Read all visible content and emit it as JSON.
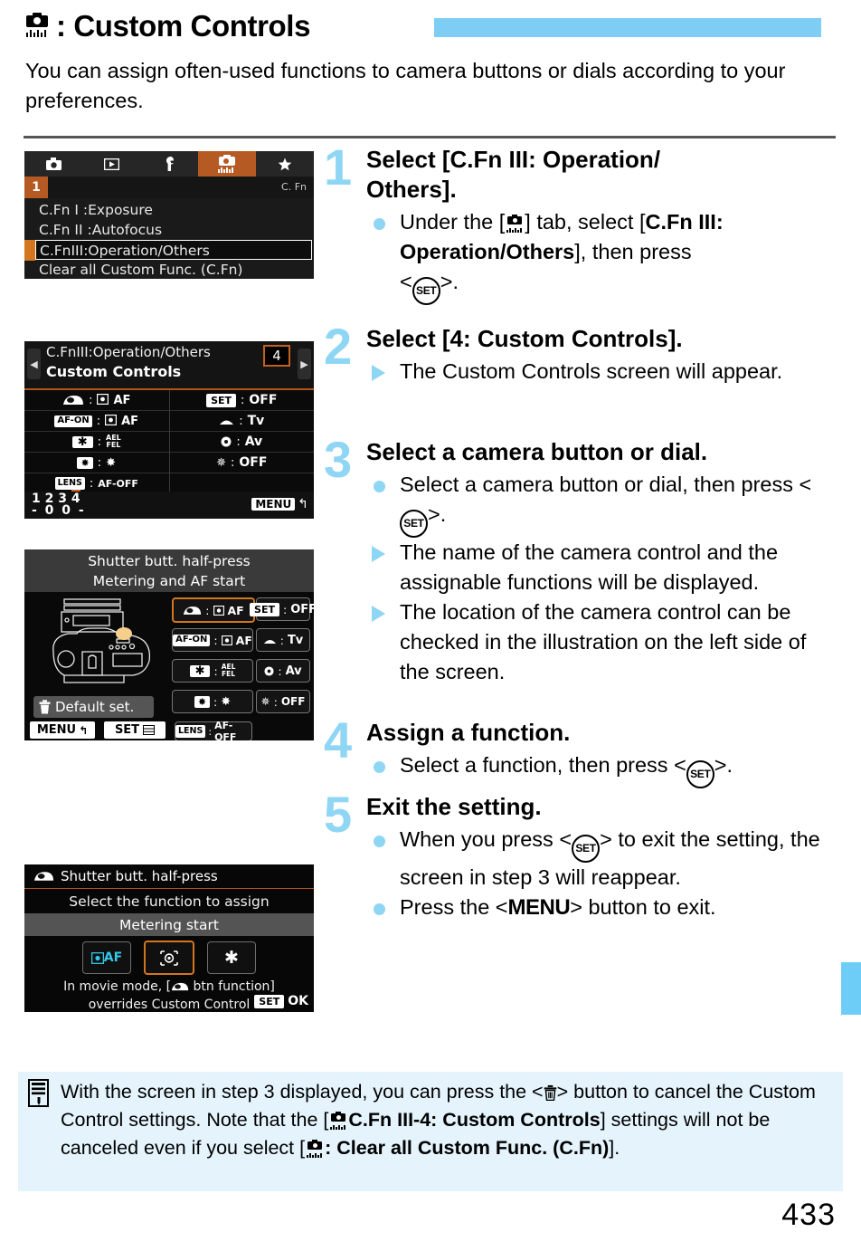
{
  "header": {
    "icon": "cfn-camera-icon",
    "title": ": Custom Controls",
    "accent_bar_color": "#7ecdf5"
  },
  "intro": "You can assign often-used functions to camera buttons or dials according to your preferences.",
  "screens": {
    "screen1": {
      "tabs": [
        "camera-icon",
        "playback-icon",
        "wrench-icon",
        "cfn-icon",
        "star-icon"
      ],
      "active_tab_index": 3,
      "page_badge": "1",
      "group_label": "C. Fn",
      "items": [
        {
          "label": "C.Fn I :Exposure",
          "selected": false
        },
        {
          "label": "C.Fn II :Autofocus",
          "selected": false
        },
        {
          "label": "C.FnIII:Operation/Others",
          "selected": true
        },
        {
          "label": "Clear all Custom Func. (C.Fn)",
          "selected": false
        }
      ]
    },
    "screen2": {
      "title_line1": "C.FnIII:Operation/Others",
      "title_line2": "Custom Controls",
      "number_badge": "4",
      "left_rows": [
        {
          "control": "shutter-button-icon",
          "value": "AF",
          "value_prefix": "metering-af-icon"
        },
        {
          "control": "AF-ON",
          "value": "AF",
          "value_prefix": "metering-af-icon"
        },
        {
          "control": "ael-star-icon",
          "value": "AEL\nFEL"
        },
        {
          "control": "flash-icon",
          "value": "flash-icon"
        },
        {
          "control": "LENS",
          "value": "AF-OFF"
        }
      ],
      "right_rows": [
        {
          "control": "SET",
          "value": "OFF"
        },
        {
          "control": "main-dial-icon",
          "value": "Tv"
        },
        {
          "control": "quick-control-dial-icon",
          "value": "Av"
        },
        {
          "control": "multi-controller-icon",
          "value": "OFF"
        }
      ],
      "page_numbers": "1 2 3 4",
      "page_marks": "- 0 0 -",
      "active_page": "4",
      "menu_label": "MENU"
    },
    "screen3": {
      "title_line1": "Shutter butt. half-press",
      "title_line2": "Metering and AF start",
      "illustration": "camera-top-view-illustration",
      "default_set_label": "Default set.",
      "menu_label": "MENU",
      "set_label": "SET",
      "buttons": [
        {
          "control": "shutter-button-icon",
          "value": "AF",
          "highlighted": true
        },
        {
          "control": "SET",
          "value": "OFF",
          "highlighted": false
        },
        {
          "control": "AF-ON",
          "value": "AF",
          "highlighted": false
        },
        {
          "control": "main-dial-icon",
          "value": "Tv",
          "highlighted": false
        },
        {
          "control": "ael-star-icon",
          "value": "AEL FEL",
          "highlighted": false
        },
        {
          "control": "quick-control-dial-icon",
          "value": "Av",
          "highlighted": false
        },
        {
          "control": "flash-icon",
          "value": "flash-icon",
          "highlighted": false
        },
        {
          "control": "multi-controller-icon",
          "value": "OFF",
          "highlighted": false
        },
        {
          "control": "LENS",
          "value": "AF-OFF",
          "highlighted": false
        }
      ]
    },
    "screen4": {
      "header": "Shutter butt. half-press",
      "subtitle": "Select the function to assign",
      "current_value": "Metering start",
      "options": [
        {
          "icon": "metering-af-icon",
          "label": "AF",
          "selected": false
        },
        {
          "icon": "metering-start-icon",
          "label": "",
          "selected": true
        },
        {
          "icon": "ael-star-icon",
          "label": "",
          "selected": false
        }
      ],
      "note_line1": "In movie mode, [",
      "note_line1b": " btn function]",
      "note_line2": "overrides Custom Control",
      "ok_key": "SET",
      "ok_label": "OK"
    }
  },
  "steps": [
    {
      "number": "1",
      "heading": "Select [C.Fn III: Operation/ Others].",
      "bullets": [
        {
          "type": "dot",
          "html": "Under the [<span class=\"cfn-inline\"><i class=\"b\"></i><i class=\"t\"></i><i class=\"l\"></i></span>] tab, select [<b>C.Fn III: Operation/Others</b>], then press &lt;SETKEY&gt;."
        }
      ]
    },
    {
      "number": "2",
      "heading": "Select [4: Custom Controls].",
      "bullets": [
        {
          "type": "tri",
          "html": "The Custom Controls screen will appear."
        }
      ]
    },
    {
      "number": "3",
      "heading": "Select a camera button or dial.",
      "bullets": [
        {
          "type": "dot",
          "html": "Select a camera button or dial, then press &lt;SETKEY&gt;."
        },
        {
          "type": "tri",
          "html": "The name of the camera control and the assignable functions will be displayed."
        },
        {
          "type": "tri",
          "html": "The location of the camera control can be checked in the illustration on the left side of the screen."
        }
      ]
    },
    {
      "number": "4",
      "heading": "Assign a function.",
      "bullets": [
        {
          "type": "dot",
          "html": "Select a function, then press &lt;SETKEY&gt;."
        }
      ]
    },
    {
      "number": "5",
      "heading": "Exit the setting.",
      "bullets": [
        {
          "type": "dot",
          "html": "When you press &lt;SETKEY&gt; to exit the setting, the screen in step 3 will reappear."
        },
        {
          "type": "dot",
          "html": "Press the &lt;MENU&gt; button to exit."
        }
      ]
    }
  ],
  "note": {
    "icon": "note-memo-icon",
    "text_part1": "With the screen in step 3 displayed, you can press the <",
    "trash": "trash-icon",
    "text_part2": "> button to cancel the Custom Control settings. Note that the [",
    "bold1": "C.Fn III-4: Custom Controls",
    "text_part3": "] settings will not be canceled even if you select [",
    "bold2": ": Clear all Custom Func. (C.Fn)",
    "text_part4": "]."
  },
  "page_number": "433",
  "side_tab_color": "#6ecdf6",
  "colors": {
    "accent_blue": "#8fd6f5",
    "orange_highlight": "#d4761f",
    "note_background": "#e4f3fc",
    "af_cyan": "#35c8e8"
  }
}
